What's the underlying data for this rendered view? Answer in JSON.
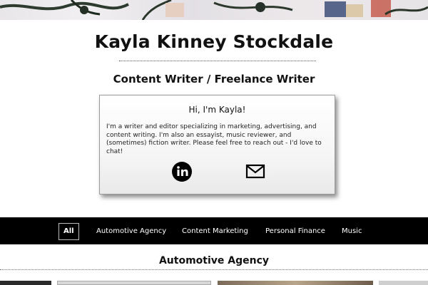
{
  "header": {
    "name": "Kayla Kinney Stockdale",
    "subtitle": "Content Writer / Freelance Writer"
  },
  "intro": {
    "greeting": "Hi, I'm Kayla!",
    "body": "I'm a writer and editor specializing in marketing, advertising, and content writing. I'm also an essayist, music reviewer, and (sometimes) fiction writer. Please feel free to reach out - I'd love to chat!",
    "icons": [
      "linkedin-icon",
      "mail-icon"
    ]
  },
  "filters": {
    "items": [
      "All",
      "Automotive Agency",
      "Content Marketing",
      "Personal Finance",
      "Music"
    ],
    "active": "All"
  },
  "section": {
    "title": "Automotive Agency"
  },
  "colors": {
    "filter_bar_bg": "#000000",
    "text": "#111111"
  }
}
